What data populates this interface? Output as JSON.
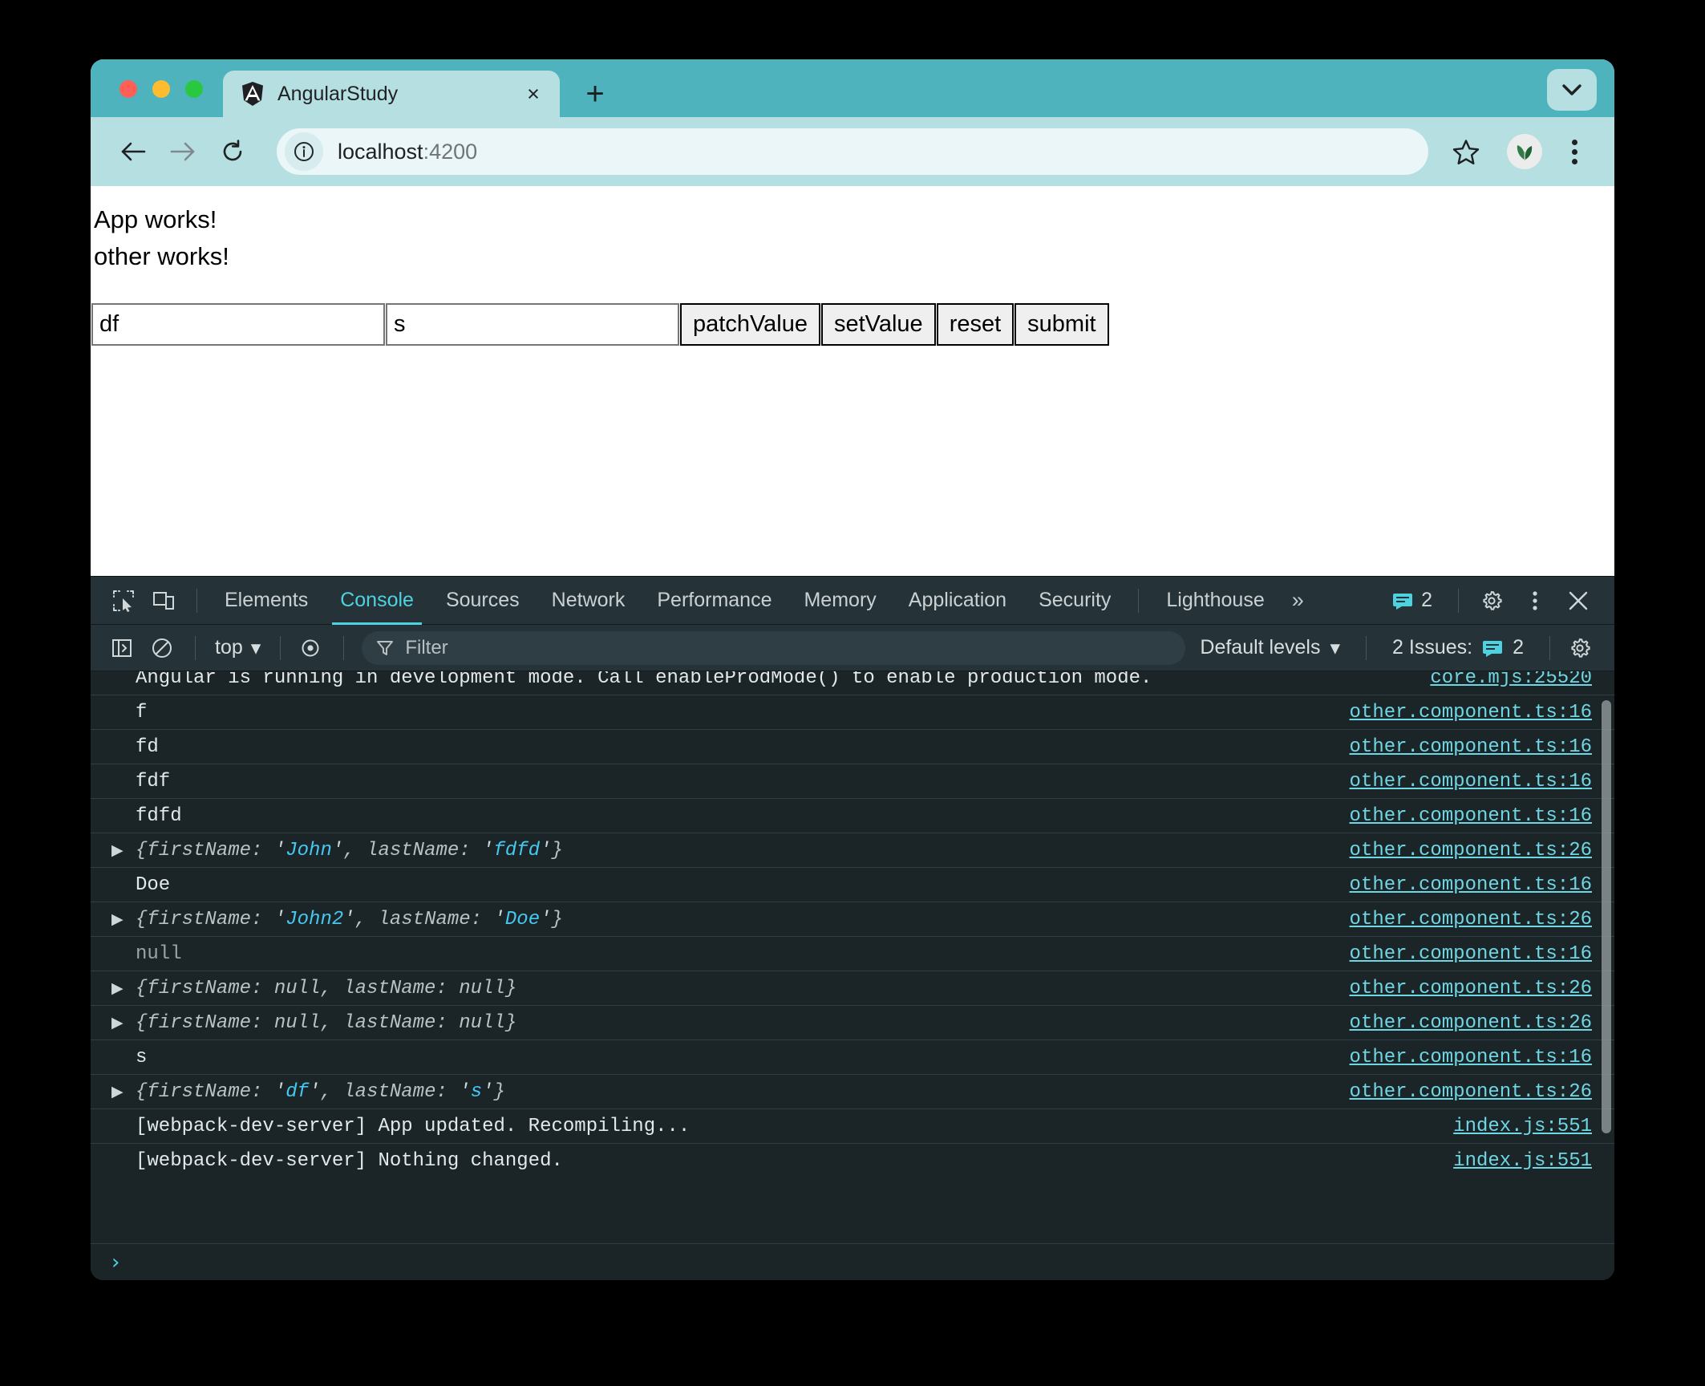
{
  "window": {
    "traffic_lights": [
      "close",
      "minimize",
      "maximize"
    ]
  },
  "tab_strip": {
    "active_tab": {
      "title": "AngularStudy",
      "favicon": "angular-logo",
      "close_label": "×"
    },
    "new_tab_label": "+",
    "tab_search_icon": "chevron-down-icon"
  },
  "toolbar": {
    "back_icon": "arrow-left-icon",
    "forward_icon": "arrow-right-icon",
    "reload_icon": "reload-icon",
    "site_info_icon": "info-circle-icon",
    "url_main": "localhost",
    "url_port": ":4200",
    "bookmark_icon": "star-icon",
    "avatar_icon": "plant-avatar",
    "menu_icon": "three-dots-vertical-icon"
  },
  "page": {
    "app_heading": "App works!",
    "other_heading": "other works!",
    "form": {
      "first_name_value": "df",
      "last_name_value": "s",
      "buttons": [
        {
          "label": "patchValue",
          "name": "patch-value-button"
        },
        {
          "label": "setValue",
          "name": "set-value-button"
        },
        {
          "label": "reset",
          "name": "reset-button"
        },
        {
          "label": "submit",
          "name": "submit-button"
        }
      ]
    }
  },
  "devtools": {
    "inspect_icon": "inspect-element-icon",
    "device_toolbar_icon": "device-toolbar-icon",
    "tabs": [
      {
        "label": "Elements",
        "active": false
      },
      {
        "label": "Console",
        "active": true
      },
      {
        "label": "Sources",
        "active": false
      },
      {
        "label": "Network",
        "active": false
      },
      {
        "label": "Performance",
        "active": false
      },
      {
        "label": "Memory",
        "active": false
      },
      {
        "label": "Application",
        "active": false
      },
      {
        "label": "Security",
        "active": false
      },
      {
        "label": "Lighthouse",
        "active": false
      }
    ],
    "overflow_label": "»",
    "issues_count": "2",
    "issues_icon": "message-icon",
    "settings_icon": "gear-icon",
    "more_icon": "three-dots-vertical-icon",
    "close_icon": "close-icon",
    "console_toolbar": {
      "sidebar_icon": "console-sidebar-icon",
      "clear_icon": "clear-console-icon",
      "context_label": "top",
      "context_caret": "▾",
      "eye_icon": "live-expression-eye-icon",
      "filter_icon": "filter-funnel-icon",
      "filter_placeholder": "Filter",
      "filter_value": "",
      "levels_label": "Default levels",
      "levels_caret": "▾",
      "issues_label": "2 Issues:",
      "issues_count": "2",
      "settings_icon": "gear-icon"
    },
    "console_prompt_caret": "›",
    "log": [
      {
        "text": "Angular is running in development mode. Call enableProdMode() to enable production mode.",
        "source": "core.mjs:25520",
        "kind": "text"
      },
      {
        "text": "f",
        "source": "other.component.ts:16",
        "kind": "text"
      },
      {
        "text": "fd",
        "source": "other.component.ts:16",
        "kind": "text"
      },
      {
        "text": "fdf",
        "source": "other.component.ts:16",
        "kind": "text"
      },
      {
        "text": "fdfd",
        "source": "other.component.ts:16",
        "kind": "text"
      },
      {
        "kind": "object",
        "source": "other.component.ts:26",
        "first_name": "'John'",
        "last_name": "'fdfd'",
        "first_is_string": true,
        "last_is_string": true
      },
      {
        "text": "Doe",
        "source": "other.component.ts:16",
        "kind": "text"
      },
      {
        "kind": "object",
        "source": "other.component.ts:26",
        "first_name": "'John2'",
        "last_name": "'Doe'",
        "first_is_string": true,
        "last_is_string": true
      },
      {
        "text": "null",
        "source": "other.component.ts:16",
        "kind": "text",
        "dim": true
      },
      {
        "kind": "object",
        "source": "other.component.ts:26",
        "first_name": "null",
        "last_name": "null",
        "first_is_string": false,
        "last_is_string": false
      },
      {
        "kind": "object",
        "source": "other.component.ts:26",
        "first_name": "null",
        "last_name": "null",
        "first_is_string": false,
        "last_is_string": false
      },
      {
        "text": "s",
        "source": "other.component.ts:16",
        "kind": "text"
      },
      {
        "kind": "object",
        "source": "other.component.ts:26",
        "first_name": "'df'",
        "last_name": "'s'",
        "first_is_string": true,
        "last_is_string": true
      },
      {
        "text": "[webpack-dev-server] App updated. Recompiling...",
        "source": "index.js:551",
        "kind": "text"
      },
      {
        "text": "[webpack-dev-server] Nothing changed.",
        "source": "index.js:551",
        "kind": "text"
      }
    ],
    "object_key_first": "firstName",
    "object_key_last": "lastName",
    "disclosure_triangle": "▶"
  },
  "colors": {
    "browser_accent": "#4eb3bd",
    "toolbar_bg": "#b6dfe2",
    "devtools_bg": "#253238",
    "console_bg": "#1b2427",
    "link_cyan": "#6fd6e3",
    "string_cyan": "#45c8f1"
  }
}
